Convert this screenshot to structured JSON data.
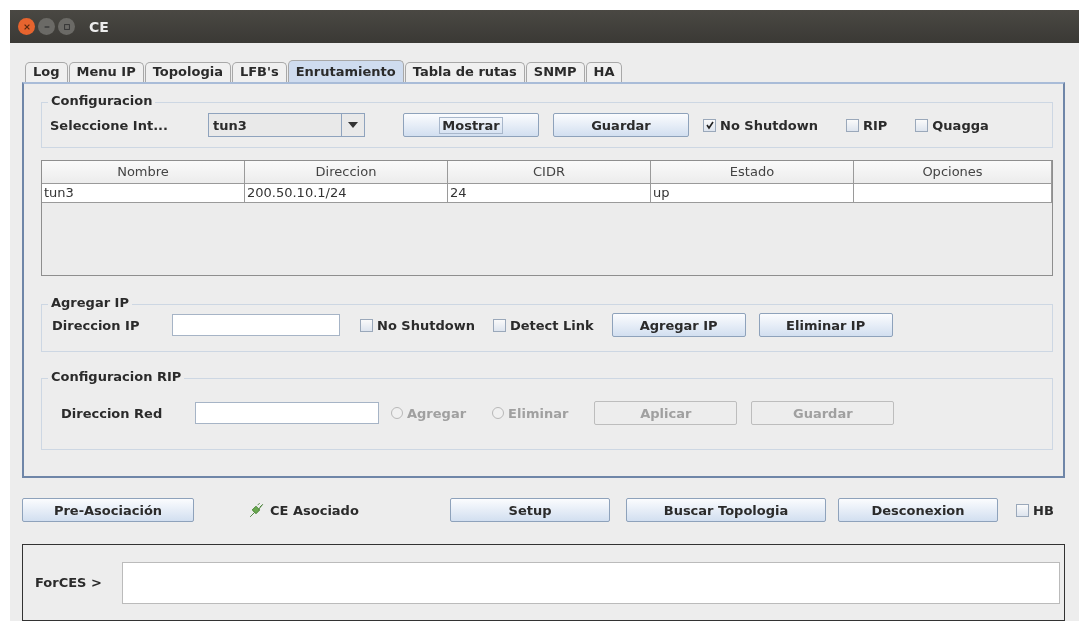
{
  "window": {
    "title": "CE"
  },
  "tabs": [
    {
      "label": "Log",
      "selected": false
    },
    {
      "label": "Menu IP",
      "selected": false
    },
    {
      "label": "Topologia",
      "selected": false
    },
    {
      "label": "LFB's",
      "selected": false
    },
    {
      "label": "Enrutamiento",
      "selected": true
    },
    {
      "label": "Tabla de rutas",
      "selected": false
    },
    {
      "label": "SNMP",
      "selected": false
    },
    {
      "label": "HA",
      "selected": false
    }
  ],
  "configuracion": {
    "title": "Configuracion",
    "label": "Seleccione Int...",
    "interface": "tun3",
    "buttons": [
      {
        "label": "Mostrar",
        "focused": true
      },
      {
        "label": "Guardar",
        "focused": false
      }
    ],
    "checkboxes": [
      {
        "label": "No Shutdown",
        "checked": true
      },
      {
        "label": "RIP",
        "checked": false
      },
      {
        "label": "Quagga",
        "checked": false
      }
    ]
  },
  "table": {
    "columns": [
      "Nombre",
      "Direccion",
      "CIDR",
      "Estado",
      "Opciones"
    ],
    "rows": [
      [
        "tun3",
        "200.50.10.1/24",
        "24",
        "up",
        ""
      ]
    ]
  },
  "agregar_ip": {
    "title": "Agregar IP",
    "label": "Direccion IP",
    "checkboxes": [
      {
        "label": "No Shutdown",
        "checked": false
      },
      {
        "label": "Detect Link",
        "checked": false
      }
    ],
    "buttons": [
      {
        "label": "Agregar IP",
        "disabled": false
      },
      {
        "label": "Eliminar IP",
        "disabled": false
      }
    ]
  },
  "configuracion_rip": {
    "title": "Configuracion RIP",
    "label": "Direccion Red",
    "radios": [
      {
        "label": "Agregar",
        "selected": false,
        "disabled": true
      },
      {
        "label": "Eliminar",
        "selected": false,
        "disabled": true
      }
    ],
    "buttons": [
      {
        "label": "Aplicar",
        "disabled": true
      },
      {
        "label": "Guardar",
        "disabled": true
      }
    ]
  },
  "bottom_bar": {
    "pre_button": "Pre-Asociación",
    "status": "CE Asociado",
    "buttons": [
      "Setup",
      "Buscar Topologia",
      "Desconexion"
    ],
    "hb": {
      "label": "HB",
      "checked": false
    }
  },
  "console": {
    "prompt": "ForCES >"
  }
}
